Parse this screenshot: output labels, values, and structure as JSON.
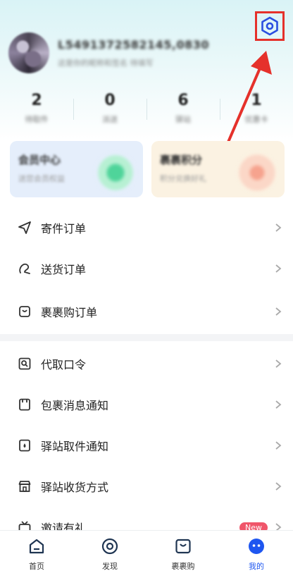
{
  "profile": {
    "username": "L5491372582145,0830",
    "note": "这是你的昵称和签名 待填写"
  },
  "stats": [
    {
      "value": "2",
      "label": "待取件"
    },
    {
      "value": "0",
      "label": "派送"
    },
    {
      "value": "6",
      "label": "驿站"
    },
    {
      "value": "1",
      "label": "优惠卡"
    }
  ],
  "cards": [
    {
      "title": "会员中心",
      "subtitle": "送您会员权益"
    },
    {
      "title": "裹裹积分",
      "subtitle": "积分兑换好礼"
    }
  ],
  "menu_top": [
    {
      "label": "寄件订单",
      "icon": "send-icon"
    },
    {
      "label": "送货订单",
      "icon": "delivery-icon"
    },
    {
      "label": "裹裹购订单",
      "icon": "shopping-bag-icon"
    }
  ],
  "menu_bottom": [
    {
      "label": "代取口令",
      "icon": "pickup-code-icon"
    },
    {
      "label": "包裹消息通知",
      "icon": "package-notify-icon"
    },
    {
      "label": "驿站取件通知",
      "icon": "station-notify-icon"
    },
    {
      "label": "驿站收货方式",
      "icon": "store-icon"
    },
    {
      "label": "邀请有礼",
      "icon": "gift-tv-icon",
      "badge": "New"
    }
  ],
  "nav": [
    {
      "label": "首页",
      "icon": "home-icon"
    },
    {
      "label": "发现",
      "icon": "discover-icon"
    },
    {
      "label": "裹裹购",
      "icon": "shop-icon"
    },
    {
      "label": "我的",
      "icon": "profile-icon",
      "active": true
    }
  ],
  "colors": {
    "accent": "#1e56f0",
    "annotation": "#e5312b",
    "badge": "#f0556a"
  }
}
